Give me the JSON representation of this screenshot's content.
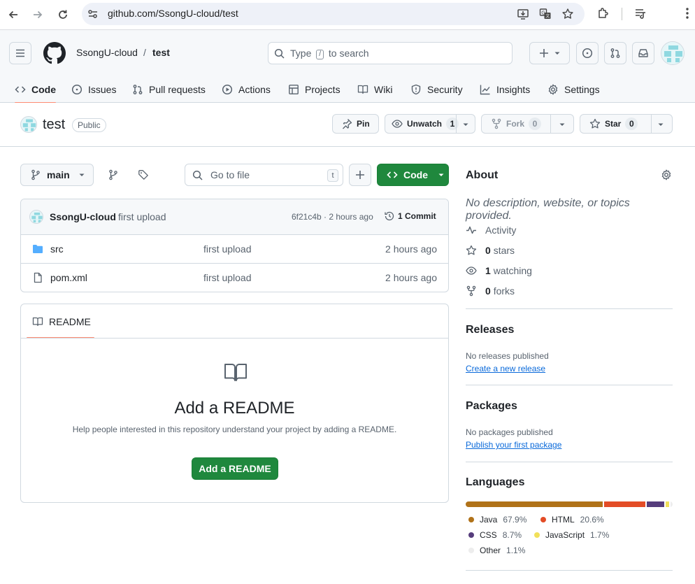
{
  "browser": {
    "url": "github.com/SsongU-cloud/test"
  },
  "header": {
    "owner": "SsongU-cloud",
    "separator": "/",
    "repo": "test",
    "search_prefix": "Type",
    "search_key": "/",
    "search_suffix": "to search"
  },
  "tabs": [
    {
      "label": "Code",
      "icon": "code-icon",
      "active": true
    },
    {
      "label": "Issues",
      "icon": "issue-opened-icon"
    },
    {
      "label": "Pull requests",
      "icon": "git-pull-request-icon"
    },
    {
      "label": "Actions",
      "icon": "play-icon"
    },
    {
      "label": "Projects",
      "icon": "table-icon"
    },
    {
      "label": "Wiki",
      "icon": "book-icon"
    },
    {
      "label": "Security",
      "icon": "shield-icon"
    },
    {
      "label": "Insights",
      "icon": "graph-icon"
    },
    {
      "label": "Settings",
      "icon": "gear-icon"
    }
  ],
  "repo": {
    "name": "test",
    "visibility": "Public",
    "pin_label": "Pin",
    "watch_label": "Unwatch",
    "watch_count": "1",
    "fork_label": "Fork",
    "fork_count": "0",
    "star_label": "Star",
    "star_count": "0"
  },
  "toolbar": {
    "branch": "main",
    "goto_placeholder": "Go to file",
    "goto_key": "t",
    "code_label": "Code"
  },
  "commit": {
    "author": "SsongU-cloud",
    "message": "first upload",
    "hash_time": "6f21c4b · 2 hours ago",
    "count_label": "1 Commit"
  },
  "files": [
    {
      "name": "src",
      "type": "folder",
      "message": "first upload",
      "date": "2 hours ago"
    },
    {
      "name": "pom.xml",
      "type": "file",
      "message": "first upload",
      "date": "2 hours ago"
    }
  ],
  "readme": {
    "tab_label": "README",
    "title": "Add a README",
    "description": "Help people interested in this repository understand your project by adding a README.",
    "button": "Add a README"
  },
  "about": {
    "heading": "About",
    "description": "No description, website, or topics provided.",
    "activity": "Activity",
    "stars_count": "0",
    "stars_label": "stars",
    "watching_count": "1",
    "watching_label": "watching",
    "forks_count": "0",
    "forks_label": "forks"
  },
  "releases": {
    "heading": "Releases",
    "text": "No releases published",
    "link": "Create a new release"
  },
  "packages": {
    "heading": "Packages",
    "text": "No packages published",
    "link": "Publish your first package"
  },
  "languages": {
    "heading": "Languages",
    "items": [
      {
        "name": "Java",
        "pct": "67.9%",
        "value": 67.9,
        "color": "#b07219"
      },
      {
        "name": "HTML",
        "pct": "20.6%",
        "value": 20.6,
        "color": "#e34c26"
      },
      {
        "name": "CSS",
        "pct": "8.7%",
        "value": 8.7,
        "color": "#563d7c"
      },
      {
        "name": "JavaScript",
        "pct": "1.7%",
        "value": 1.7,
        "color": "#f1e05a"
      },
      {
        "name": "Other",
        "pct": "1.1%",
        "value": 1.1,
        "color": "#ededed"
      }
    ]
  }
}
